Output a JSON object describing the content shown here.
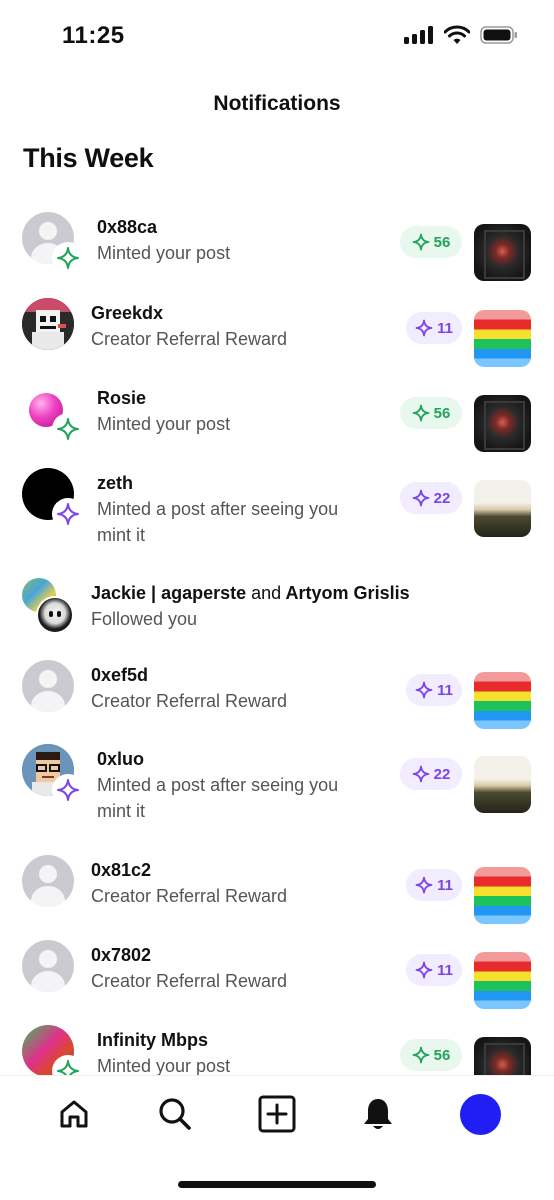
{
  "status": {
    "time": "11:25"
  },
  "header": {
    "title": "Notifications"
  },
  "section": {
    "title": "This Week"
  },
  "notifications": [
    {
      "name": "0x88ca",
      "text": "Minted your post",
      "count": "56",
      "pill": "green",
      "badge": "green",
      "thumb": "hall"
    },
    {
      "name": "Greekdx",
      "text": "Creator Referral Reward",
      "count": "11",
      "pill": "purple",
      "thumb": "stripes"
    },
    {
      "name": "Rosie",
      "text": "Minted your post",
      "count": "56",
      "pill": "green",
      "badge": "green",
      "thumb": "hall"
    },
    {
      "name": "zeth",
      "text": "Minted a post after seeing you",
      "text2": "mint it",
      "count": "22",
      "pill": "purple",
      "badge": "purple",
      "thumb": "field"
    },
    {
      "name": "Jackie | agaperste",
      "joiner": "and",
      "name2": "Artyom Grislis",
      "text": "Followed you"
    },
    {
      "name": "0xef5d",
      "text": "Creator Referral Reward",
      "count": "11",
      "pill": "purple",
      "thumb": "stripes"
    },
    {
      "name": "0xluo",
      "text": "Minted a post after seeing you",
      "text2": "mint it",
      "count": "22",
      "pill": "purple",
      "badge": "purple",
      "thumb": "field"
    },
    {
      "name": "0x81c2",
      "text": "Creator Referral Reward",
      "count": "11",
      "pill": "purple",
      "thumb": "stripes"
    },
    {
      "name": "0x7802",
      "text": "Creator Referral Reward",
      "count": "11",
      "pill": "purple",
      "thumb": "stripes"
    },
    {
      "name": "Infinity Mbps",
      "text": "Minted your post",
      "count": "56",
      "pill": "green",
      "badge": "green",
      "thumb": "hall"
    }
  ],
  "tabs": [
    {
      "icon": "home-icon"
    },
    {
      "icon": "search-icon"
    },
    {
      "icon": "create-post-icon"
    },
    {
      "icon": "bell-icon"
    },
    {
      "icon": "profile-avatar"
    }
  ],
  "colors": {
    "green": "#22a35a",
    "purple": "#7b45e5",
    "profile": "#1f1ff5"
  }
}
